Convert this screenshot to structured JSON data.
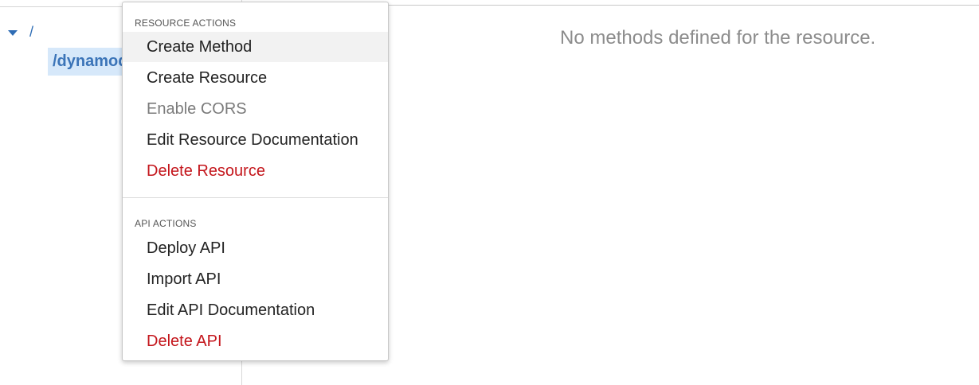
{
  "tree": {
    "root_label": "/",
    "child_label": "/dynamodb"
  },
  "main": {
    "empty_message": "No methods defined for the resource."
  },
  "menu": {
    "resource_actions_header": "RESOURCE ACTIONS",
    "resource_actions": [
      {
        "label": "Create Method",
        "state": "hover"
      },
      {
        "label": "Create Resource",
        "state": "normal"
      },
      {
        "label": "Enable CORS",
        "state": "disabled"
      },
      {
        "label": "Edit Resource Documentation",
        "state": "normal"
      },
      {
        "label": "Delete Resource",
        "state": "danger"
      }
    ],
    "api_actions_header": "API ACTIONS",
    "api_actions": [
      {
        "label": "Deploy API",
        "state": "normal"
      },
      {
        "label": "Import API",
        "state": "normal"
      },
      {
        "label": "Edit API Documentation",
        "state": "normal"
      },
      {
        "label": "Delete API",
        "state": "danger"
      }
    ]
  },
  "colors": {
    "link_blue": "#2f6db5",
    "selected_bg": "#d6e8fa",
    "danger_red": "#c4161c",
    "disabled_gray": "#7b7b7b"
  },
  "icons": {
    "tree_toggle": "caret-down-icon"
  }
}
